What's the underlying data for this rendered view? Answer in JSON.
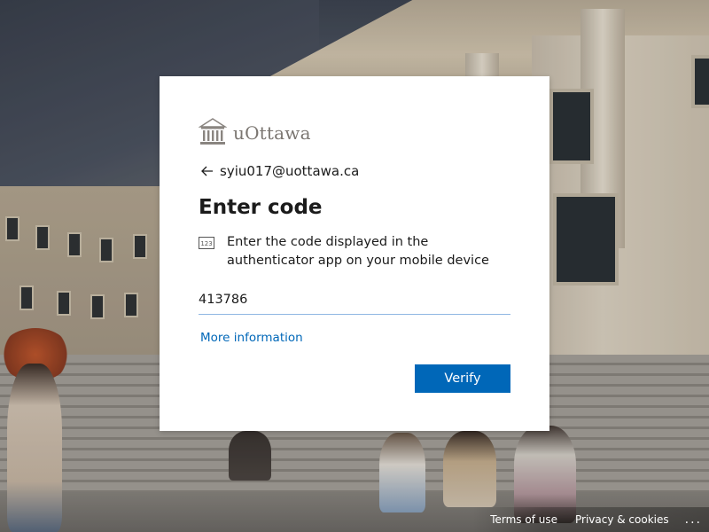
{
  "background": {
    "description_icon": "campus-background-image"
  },
  "logo": {
    "text": "uOttawa",
    "icon": "uottawa-building-logo-icon"
  },
  "identity": {
    "back_icon": "back-arrow-icon",
    "email": "syiu017@uottawa.ca"
  },
  "title": "Enter code",
  "description": {
    "icon": "keypad-123-icon",
    "text": "Enter the code displayed in the authenticator app on your mobile device"
  },
  "code_input": {
    "value": "413786",
    "placeholder": ""
  },
  "more_info_link": "More information",
  "verify_button": "Verify",
  "footer": {
    "terms": "Terms of use",
    "privacy": "Privacy & cookies",
    "more": "..."
  },
  "colors": {
    "accent": "#0067b8",
    "input_underline": "#8fb7e3"
  }
}
